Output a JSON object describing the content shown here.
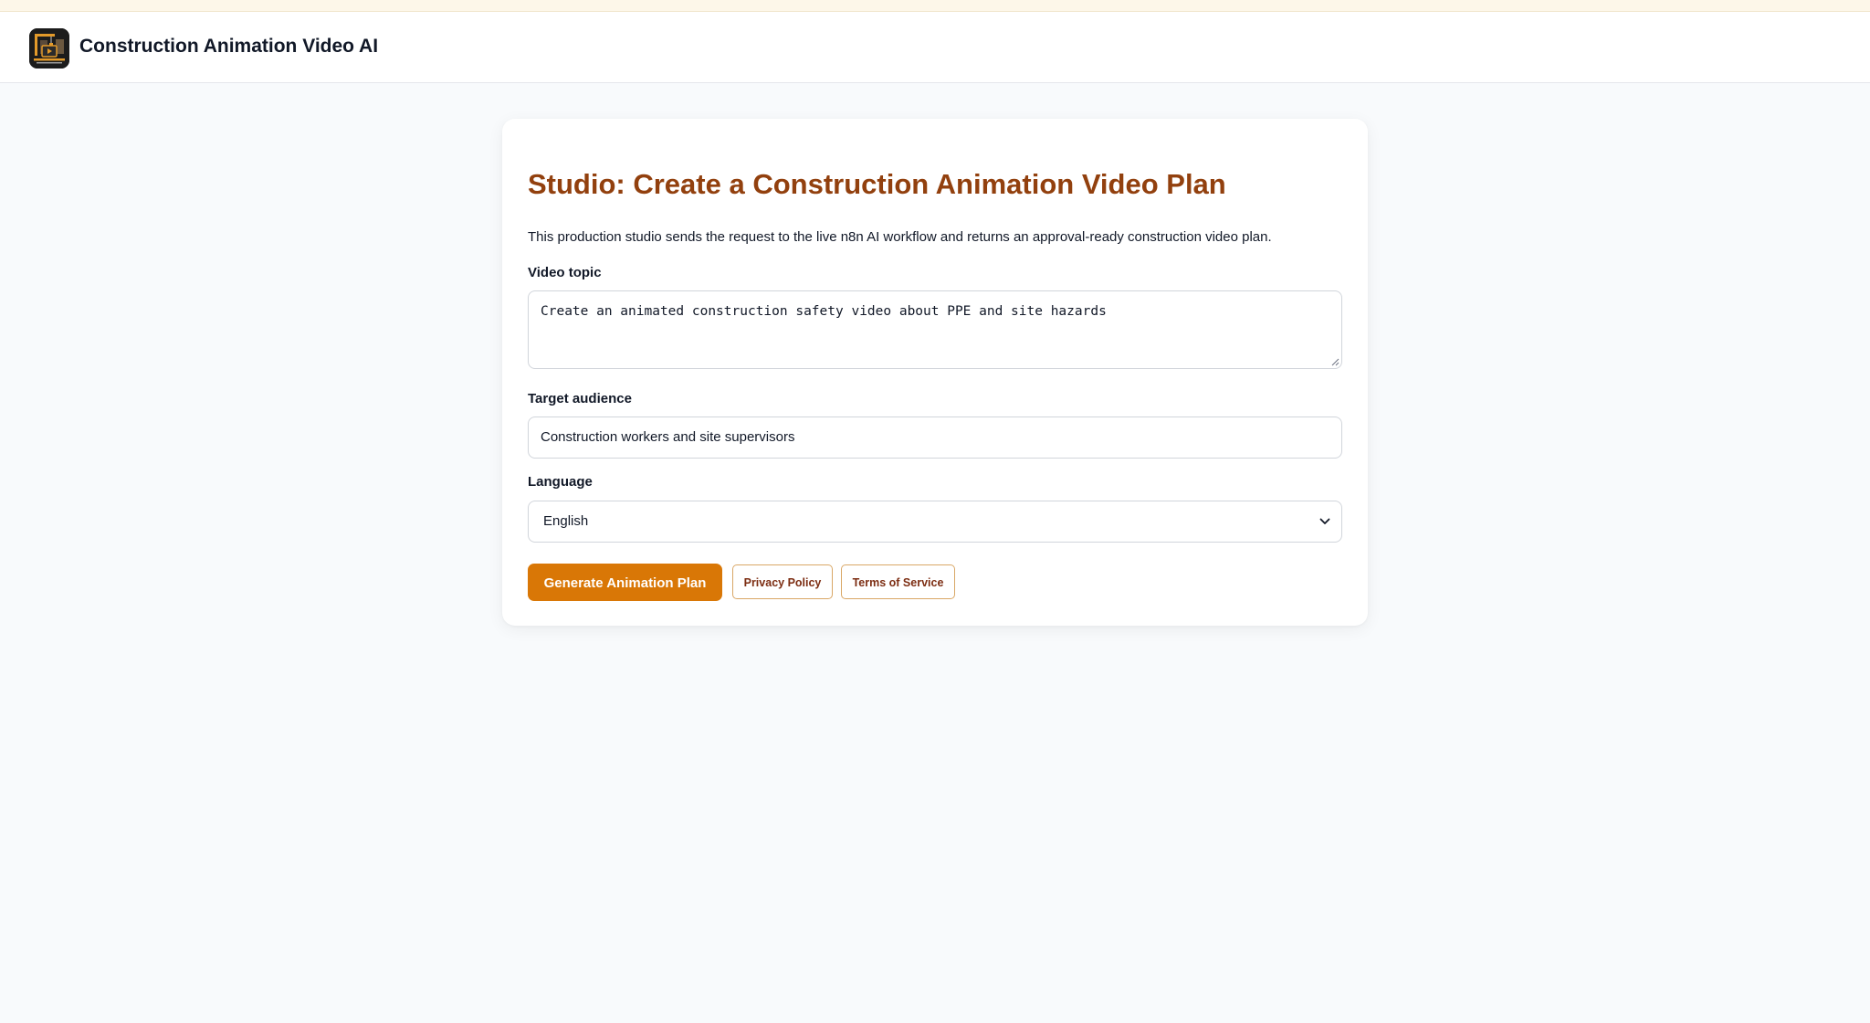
{
  "header": {
    "app_title": "Construction Animation Video AI",
    "logo_icon": "construction-logo-icon"
  },
  "studio": {
    "title": "Studio: Create a Construction Animation Video Plan",
    "description": "This production studio sends the request to the live n8n AI workflow and returns an approval-ready construction video plan."
  },
  "form": {
    "topic_label": "Video topic",
    "topic_value": "Create an animated construction safety video about PPE and site hazards",
    "audience_label": "Target audience",
    "audience_value": "Construction workers and site supervisors",
    "language_label": "Language",
    "language_value": "English"
  },
  "actions": {
    "generate_label": "Generate Animation Plan",
    "privacy_label": "Privacy Policy",
    "terms_label": "Terms of Service"
  },
  "colors": {
    "accent": "#d97706",
    "title": "#92400e",
    "page_background": "#f8fafc"
  }
}
